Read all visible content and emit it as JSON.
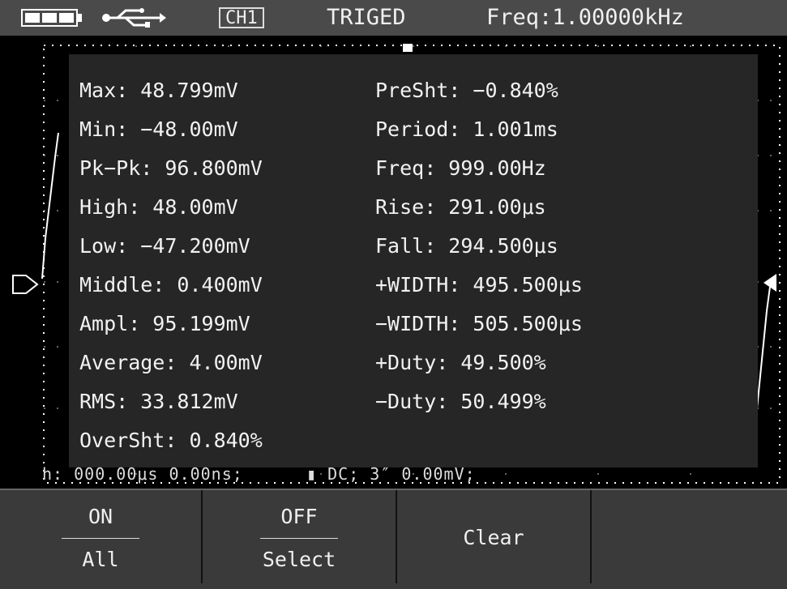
{
  "status": {
    "channel": "CH1",
    "trigger_status": "TRIGED",
    "frequency": "Freq:1.00000kHz",
    "battery_icon": "battery-icon",
    "usb_icon": "usb-icon"
  },
  "measurements": {
    "left": [
      "Max: 48.799mV",
      "Min: −48.00mV",
      "Pk−Pk: 96.800mV",
      "High: 48.00mV",
      "Low: −47.200mV",
      "Middle: 0.400mV",
      "Ampl: 95.199mV",
      "Average: 4.00mV",
      "RMS: 33.812mV",
      "OverSht: 0.840%"
    ],
    "right": [
      "PreSht: −0.840%",
      "Period: 1.001ms",
      "Freq: 999.00Hz",
      "Rise: 291.00μs",
      "Fall: 294.500μs",
      "+WIDTH: 495.500μs",
      "−WIDTH: 505.500μs",
      "+Duty: 49.500%",
      "−Duty: 50.499%"
    ]
  },
  "readout": {
    "partial_text": "h: 000.00μs 0.00ns;      ▮ DC; 3″ 0.00mV;"
  },
  "softkeys": [
    {
      "top": "ON",
      "bottom": "All"
    },
    {
      "top": "OFF",
      "bottom": "Select"
    },
    {
      "label": "Clear"
    }
  ]
}
